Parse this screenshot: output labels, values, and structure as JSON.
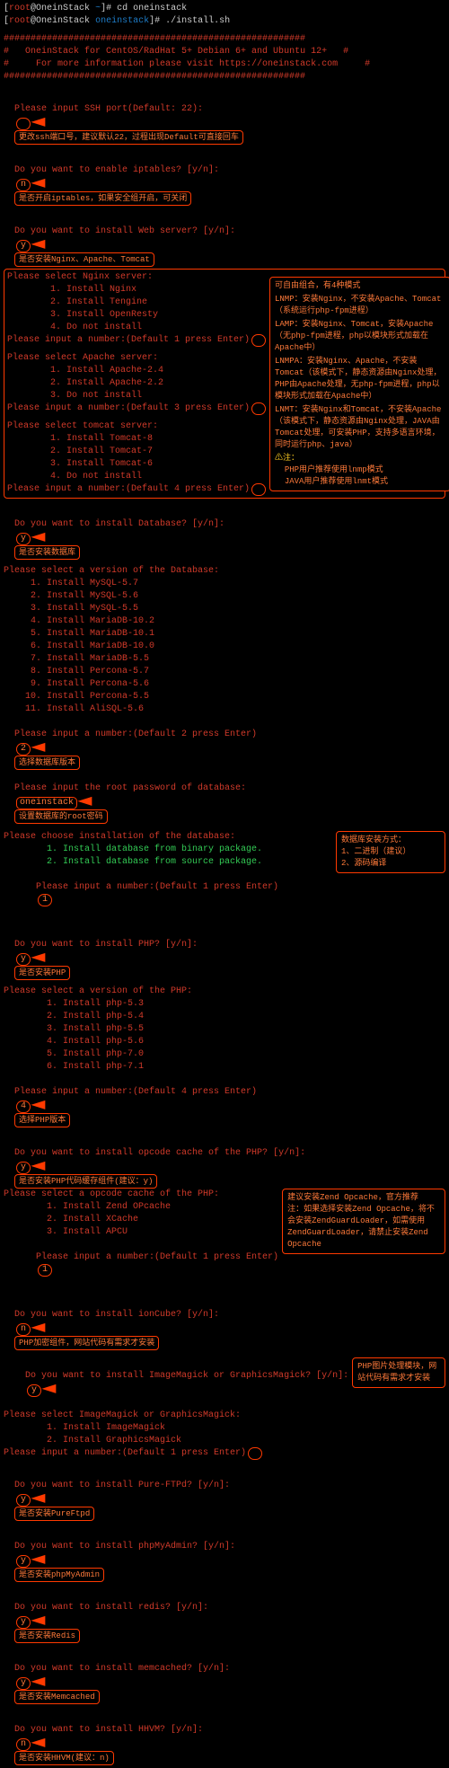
{
  "header": {
    "prompt1": {
      "user": "root",
      "host": "OneinStack",
      "path": "~",
      "cmd": "cd oneinstack"
    },
    "prompt2": {
      "user": "root",
      "host": "OneinStack",
      "path": "oneinstack",
      "cmd": "./install.sh"
    },
    "banner_line": "########################################################",
    "banner_title": "OneinStack for CentOS/RadHat 5+ Debian 6+ and Ubuntu 12+",
    "banner_info": "For more information please visit https://oneinstack.com"
  },
  "ssh": {
    "q": "Please input SSH port(Default: 22):",
    "note": "更改ssh端口号，建议默认22，过程出现Default可直接回车"
  },
  "iptables": {
    "q": "Do you want to enable iptables? [y/n]:",
    "a": "n",
    "note": "是否开启iptables，如果安全组开启，可关闭"
  },
  "web": {
    "q": "Do you want to install Web server? [y/n]:",
    "a": "y",
    "note": "是否安装Nginx、Apache、Tomcat"
  },
  "nginx": {
    "title": "Please select Nginx server:",
    "opts": [
      "1. Install Nginx",
      "2. Install Tengine",
      "3. Install OpenResty",
      "4. Do not install"
    ],
    "enter": "Please input a number:(Default 1 press Enter)"
  },
  "apache": {
    "title": "Please select Apache server:",
    "opts": [
      "1. Install Apache-2.4",
      "2. Install Apache-2.2",
      "3. Do not install"
    ],
    "enter": "Please input a number:(Default 3 press Enter)"
  },
  "tomcat": {
    "title": "Please select tomcat server:",
    "opts": [
      "1. Install Tomcat-8",
      "2. Install Tomcat-7",
      "3. Install Tomcat-6",
      "4. Do not install"
    ],
    "enter": "Please input a number:(Default 4 press Enter)"
  },
  "webside": {
    "intro": "可自由组合，有4种模式",
    "lnmp": "LNMP：安装Nginx，不安装Apache、Tomcat（系统运行php-fpm进程）",
    "lamp": "LAMP：安装Nginx、Tomcat，安装Apache（无php-fpm进程，php以模块形式加载在Apache中）",
    "lnmpa": "LNMPA：安装Nginx、Apache，不安装Tomcat（该模式下，静态资源由Nginx处理，PHP由Apache处理，无php-fpm进程，php以模块形式加载在Apache中）",
    "lnmt": "LNMT：安装Nginx和Tomcat，不安装Apache（该模式下，静态资源由Nginx处理，JAVA由Tomcat处理，可安装PHP，支持多语言环境，同时运行php、java）",
    "warn": "⚠注：",
    "php_user": "PHP用户推荐使用lnmp模式",
    "java_user": "JAVA用户推荐使用lnmt模式"
  },
  "db": {
    "q": "Do you want to install Database? [y/n]:",
    "a": "y",
    "note": "是否安装数据库",
    "ver_title": "Please select a version of the Database:",
    "vers": [
      "1. Install MySQL-5.7",
      "2. Install MySQL-5.6",
      "3. Install MySQL-5.5",
      "4. Install MariaDB-10.2",
      "5. Install MariaDB-10.1",
      "6. Install MariaDB-10.0",
      "7. Install MariaDB-5.5",
      "8. Install Percona-5.7",
      "9. Install Percona-5.6",
      "10. Install Percona-5.5",
      "11. Install AliSQL-5.6"
    ],
    "enter": "Please input a number:(Default 2 press Enter)",
    "enter_a": "2",
    "enter_note": "选择数据库版本",
    "rootpw_q": "Please input the root password of database:",
    "rootpw_a": "oneinstack",
    "rootpw_note": "设置数据库的root密码",
    "inst_title": "Please choose installation of the database:",
    "inst_opts": [
      "1. Install database from binary package.",
      "2. Install database from source package."
    ],
    "inst_enter": "Please input a number:(Default 1 press Enter)",
    "inst_a": "1",
    "inst_note_title": "数据库安装方式：",
    "inst_note1": "1、二进制（建议）",
    "inst_note2": "2、源码编译"
  },
  "php": {
    "q": "Do you want to install PHP? [y/n]:",
    "a": "y",
    "note": "是否安装PHP",
    "ver_title": "Please select a version of the PHP:",
    "vers": [
      "1. Install php-5.3",
      "2. Install php-5.4",
      "3. Install php-5.5",
      "4. Install php-5.6",
      "5. Install php-7.0",
      "6. Install php-7.1"
    ],
    "enter": "Please input a number:(Default 4 press Enter)",
    "enter_a": "4",
    "enter_note": "选择PHP版本"
  },
  "opcache": {
    "q": "Do you want to install opcode cache of the PHP? [y/n]:",
    "a": "y",
    "note": "是否安装PHP代码缓存组件(建议：y)",
    "sel_title": "Please select a opcode cache of the PHP:",
    "opts": [
      "1. Install Zend OPcache",
      "2. Install XCache",
      "3. Install APCU"
    ],
    "enter": "Please input a number:(Default 1 press Enter)",
    "enter_a": "1",
    "side1": "建议安装Zend Opcache，官方推荐",
    "side2": "注：如果选择安装Zend Opcache，将不会安装ZendGuardLoader，如需使用ZendGuardLoader，请禁止安装Zend Opcache"
  },
  "ioncube": {
    "q": "Do you want to install ionCube? [y/n]:",
    "a": "n",
    "note": "PHP加密组件，网站代码有需求才安装"
  },
  "magick": {
    "q": "Do you want to install ImageMagick or GraphicsMagick? [y/n]:",
    "a": "y",
    "note": "PHP图片处理模块，网站代码有需求才安装",
    "sel_title": "Please select ImageMagick or GraphicsMagick:",
    "opts": [
      "1. Install ImageMagick",
      "2. Install GraphicsMagick"
    ],
    "enter": "Please input a number:(Default 1 press Enter)"
  },
  "ftp": {
    "q": "Do you want to install Pure-FTPd? [y/n]:",
    "a": "y",
    "note": "是否安装PureFtpd"
  },
  "pma": {
    "q": "Do you want to install phpMyAdmin? [y/n]:",
    "a": "y",
    "note": "是否安装phpMyAdmin"
  },
  "redis": {
    "q": "Do you want to install redis? [y/n]:",
    "a": "y",
    "note": "是否安装Redis"
  },
  "memc": {
    "q": "Do you want to install memcached? [y/n]:",
    "a": "y",
    "note": "是否安装Memcached"
  },
  "hhvm": {
    "q": "Do you want to install HHVM? [y/n]:",
    "a": "n",
    "note": "是否安装HHVM(建议：n)"
  }
}
